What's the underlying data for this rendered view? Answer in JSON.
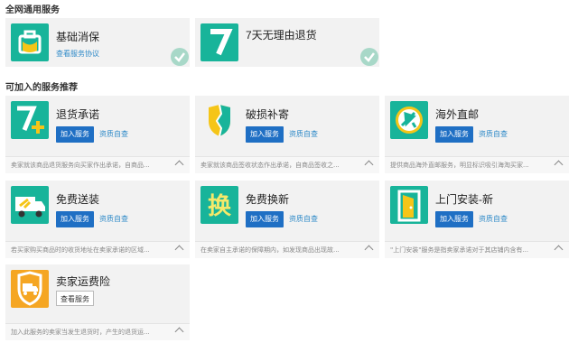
{
  "sections": {
    "general_title": "全网通用服务",
    "optional_title": "可加入的服务推荐"
  },
  "general_services": [
    {
      "title": "基础消保",
      "link": "查看服务协议",
      "icon": "suitcase-shield-icon",
      "color": "#18b49a"
    },
    {
      "title": "7天无理由退货",
      "icon": "seven-days-icon",
      "color": "#18b49a"
    }
  ],
  "optional_services": [
    {
      "title": "退货承诺",
      "icon": "seven-plus-icon",
      "color": "#18b49a",
      "add": "加入服务",
      "qual": "资质自查",
      "desc": "卖家就该商品退货服务向买家作出承诺，自商品..."
    },
    {
      "title": "破损补寄",
      "icon": "broken-shield-icon",
      "color": "#f2f2f2",
      "add": "加入服务",
      "qual": "资质自查",
      "desc": "卖家就该商品签收状态作出承诺，自商品签收之..."
    },
    {
      "title": "海外直邮",
      "icon": "airplane-icon",
      "color": "#18b49a",
      "add": "加入服务",
      "qual": "资质自查",
      "desc": "提供商品海外直邮服务，明显标识吸引海淘买家..."
    },
    {
      "title": "免费送装",
      "icon": "delivery-truck-icon",
      "color": "#18b49a",
      "add": "加入服务",
      "qual": "资质自查",
      "desc": "若买家购买商品时的收货地址在卖家承诺的区域..."
    },
    {
      "title": "免费换新",
      "icon": "exchange-char-icon",
      "color": "#18b49a",
      "add": "加入服务",
      "qual": "资质自查",
      "desc": "在卖家自主承诺的保障期内，如发现商品出现故..."
    },
    {
      "title": "上门安装-新",
      "icon": "door-install-icon",
      "color": "#18b49a",
      "add": "加入服务",
      "qual": "资质自查",
      "desc": "\"上门安装\"服务是指卖家承诺对于其店铺内含有..."
    },
    {
      "title": "卖家运费险",
      "icon": "truck-shield-icon",
      "color": "#f5a623",
      "view": "查看服务",
      "desc": "加入此服务的卖家当发生退货时，产生的退货运..."
    }
  ],
  "colors": {
    "accent": "#1f6fc4",
    "link": "#2f8ac8",
    "teal": "#18b49a",
    "check": "#a8d8c8"
  }
}
